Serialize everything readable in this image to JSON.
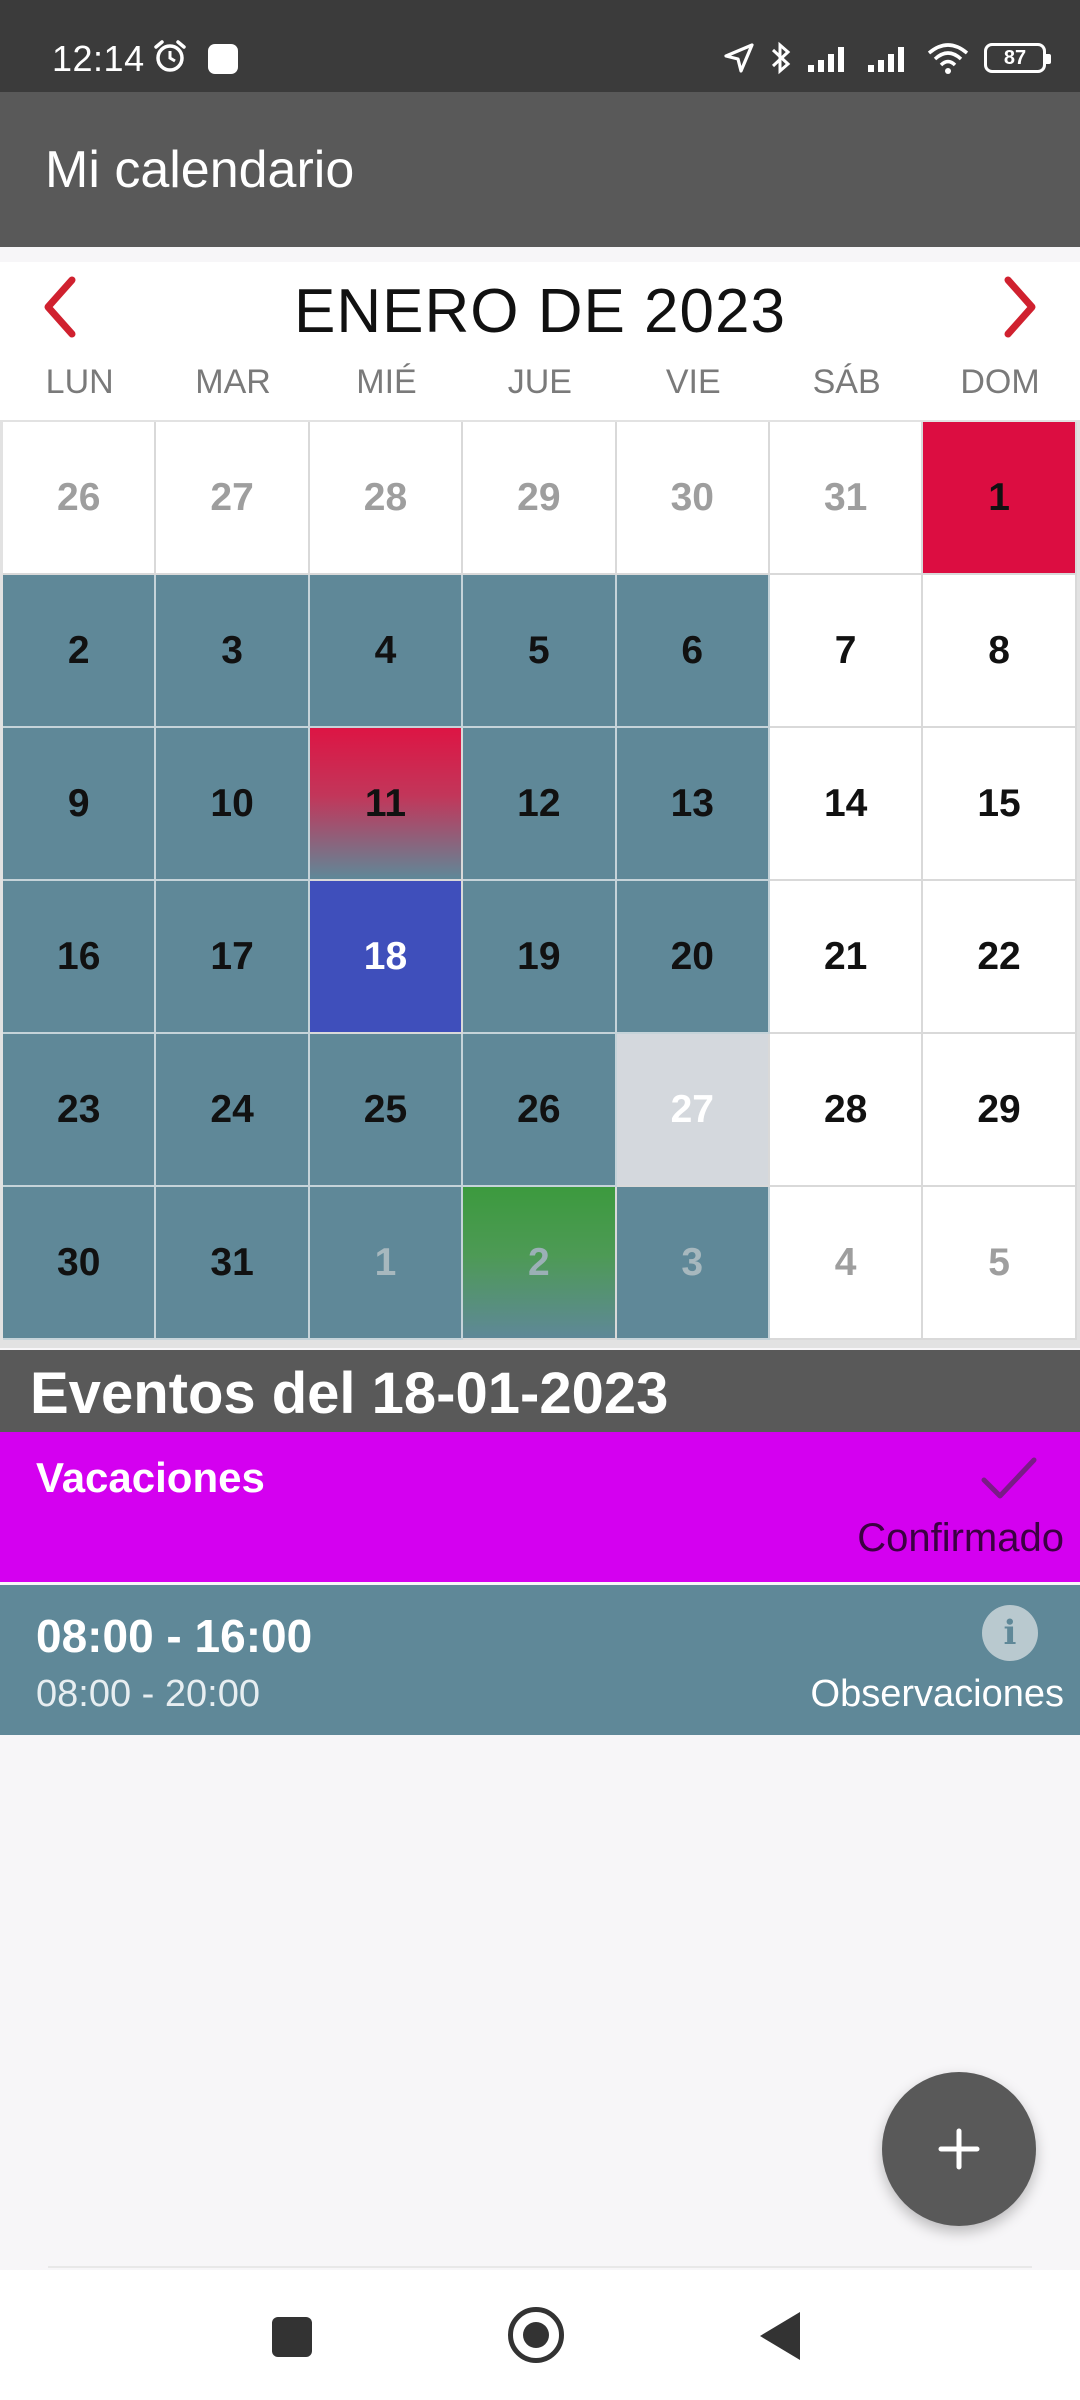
{
  "status_bar": {
    "time": "12:14",
    "battery": "87",
    "icons": [
      "alarm-icon",
      "notification-square-icon",
      "location-arrow-icon",
      "bluetooth-icon",
      "signal-icon",
      "signal-icon",
      "wifi-icon",
      "battery-icon"
    ]
  },
  "app_bar": {
    "title": "Mi calendario"
  },
  "calendar": {
    "month_title": "ENERO DE 2023",
    "prev_icon": "chevron-left-icon",
    "next_icon": "chevron-right-icon",
    "weekdays": [
      "LUN",
      "MAR",
      "MIÉ",
      "JUE",
      "VIE",
      "SÁB",
      "DOM"
    ],
    "weeks": [
      [
        "26",
        "27",
        "28",
        "29",
        "30",
        "31",
        "1"
      ],
      [
        "2",
        "3",
        "4",
        "5",
        "6",
        "7",
        "8"
      ],
      [
        "9",
        "10",
        "11",
        "12",
        "13",
        "14",
        "15"
      ],
      [
        "16",
        "17",
        "18",
        "19",
        "20",
        "21",
        "22"
      ],
      [
        "23",
        "24",
        "25",
        "26",
        "27",
        "28",
        "29"
      ],
      [
        "30",
        "31",
        "1",
        "2",
        "3",
        "4",
        "5"
      ]
    ],
    "colors": {
      "work_day": "#5f8898",
      "holiday": "#dc0d41",
      "selected": "#3f4fbb",
      "green_event": "#3c9a3e",
      "accent_nav": "#d0212f"
    }
  },
  "events": {
    "header": "Eventos del 18-01-2023",
    "items": [
      {
        "title": "Vacaciones",
        "status": "Confirmado",
        "icon": "check-icon",
        "color": "#d400f0"
      },
      {
        "title": "08:00 - 16:00",
        "subtitle": "08:00 - 20:00",
        "note": "Observaciones",
        "icon": "info-icon",
        "icon_glyph": "i",
        "color": "#5f8898"
      }
    ]
  },
  "fab": {
    "icon": "plus-icon"
  },
  "nav_bar": {
    "icons": [
      "recents-square-icon",
      "home-circle-icon",
      "back-triangle-icon"
    ]
  }
}
